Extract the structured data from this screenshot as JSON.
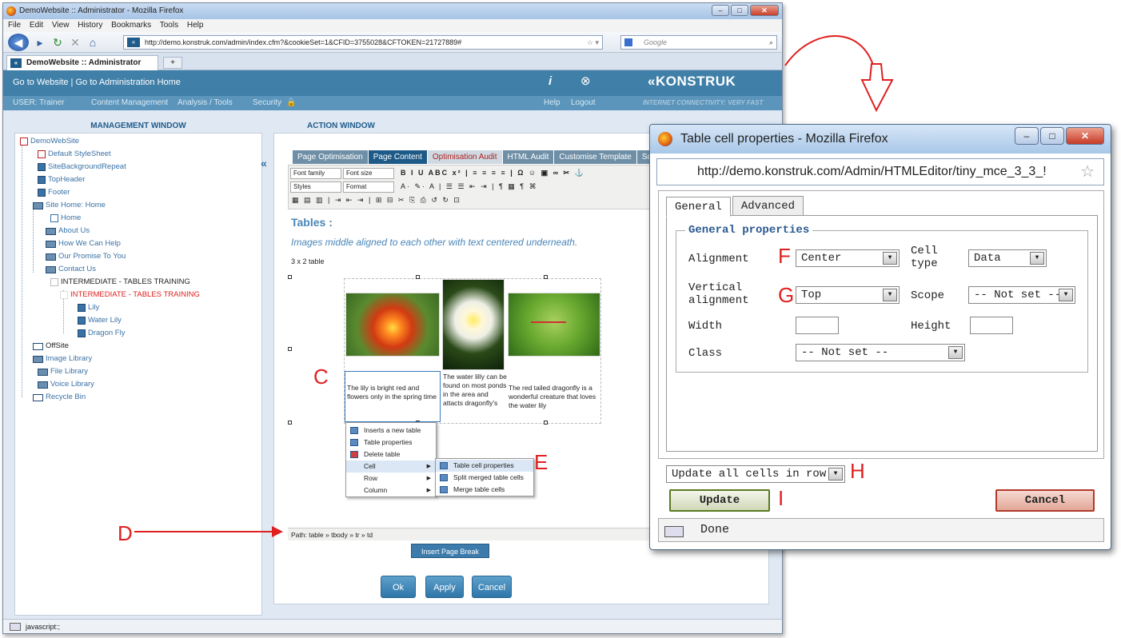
{
  "browser": {
    "title": "DemoWebsite :: Administrator - Mozilla Firefox",
    "menu": [
      "File",
      "Edit",
      "View",
      "History",
      "Bookmarks",
      "Tools",
      "Help"
    ],
    "url": "http://demo.konstruk.com/admin/index.cfm?&cookieSet=1&CFID=3755028&CFTOKEN=21727889#",
    "search_placeholder": "Google",
    "tab_label": "DemoWebsite :: Administrator",
    "status": "javascript:;"
  },
  "site": {
    "top_links": "Go to Website  |  Go to Administration Home",
    "help_label": "Help",
    "logout_label": "Logout",
    "brand": "«KONSTRUK",
    "tagline": "INTERNET CONNECTIVITY: VERY FAST",
    "nav": [
      "USER: Trainer",
      "Content Management",
      "Analysis / Tools",
      "Security"
    ]
  },
  "management": {
    "title": "MANAGEMENT WINDOW",
    "tree": [
      "DemoWebSite",
      "Default StyleSheet",
      "SiteBackgroundRepeat",
      "TopHeader",
      "Footer",
      "Site Home: Home",
      "Home",
      "About Us",
      "How We Can Help",
      "Our Promise To You",
      "Contact Us",
      "INTERMEDIATE - TABLES TRAINING",
      "INTERMEDIATE - TABLES TRAINING",
      "Lily",
      "Water Lily",
      "Dragon Fly",
      "OffSite",
      "Image Library",
      "File Library",
      "Voice Library",
      "Recycle Bin"
    ]
  },
  "action": {
    "title": "ACTION WINDOW",
    "tabs": [
      "Page Optimisation",
      "Page Content",
      "Optimisation Audit",
      "HTML Audit",
      "Customise Template",
      "Scrat"
    ],
    "toolbar": {
      "font_family": "Font family",
      "font_size": "Font size",
      "styles": "Styles",
      "format": "Format"
    },
    "heading": "Tables :",
    "subtitle": "Images middle aligned to each other with text centered underneath.",
    "table_label": "3 x 2 table",
    "cells": [
      "The lily is bright red and flowers only in the spring time",
      "The water lilly can be found on most ponds in the area and attacts dragonfly's",
      "The red tailed dragonfly is a wonderful creature that loves the water lily"
    ],
    "context_menu": [
      "Inserts a new table",
      "Table properties",
      "Delete table",
      "Cell",
      "Row",
      "Column"
    ],
    "submenu": [
      "Table cell properties",
      "Split merged table cells",
      "Merge table cells"
    ],
    "path": "Path: table » tbody » tr » td",
    "page_break": "Insert Page Break",
    "buttons": {
      "ok": "Ok",
      "apply": "Apply",
      "cancel": "Cancel"
    }
  },
  "callouts": {
    "c": "C",
    "d": "D",
    "e": "E",
    "f": "F",
    "g": "G",
    "h": "H",
    "i": "I"
  },
  "popup": {
    "title": "Table cell properties - Mozilla Firefox",
    "url": "http://demo.konstruk.com/Admin/HTMLEditor/tiny_mce_3_3_!",
    "tabs": [
      "General",
      "Advanced"
    ],
    "legend": "General properties",
    "alignment_label": "Alignment",
    "alignment_value": "Center",
    "cell_type_label": "Cell type",
    "cell_type_value": "Data",
    "valign_label": "Vertical alignment",
    "valign_value": "Top",
    "scope_label": "Scope",
    "scope_value": "-- Not set --",
    "width_label": "Width",
    "height_label": "Height",
    "class_label": "Class",
    "class_value": "-- Not set --",
    "update_scope": "Update all cells in row",
    "update_label": "Update",
    "cancel_label": "Cancel",
    "status": "Done"
  },
  "colors": {
    "brand_blue": "#3f7fa8",
    "callout_red": "#e02020",
    "accent": "#2a5a90"
  }
}
